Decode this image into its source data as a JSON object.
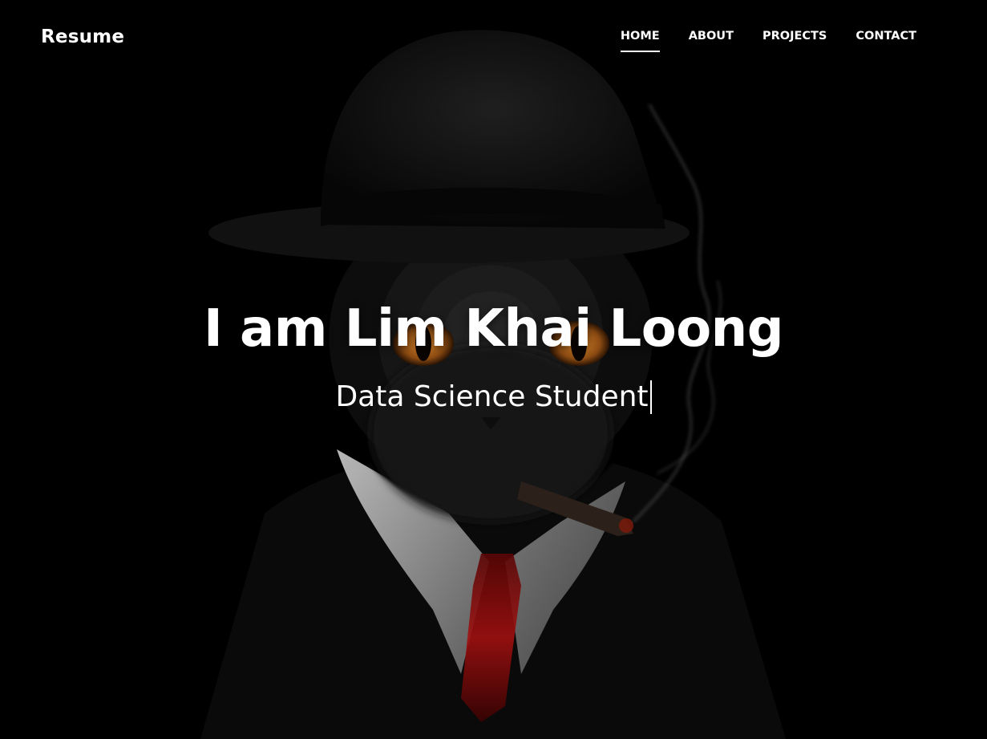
{
  "header": {
    "brand": "Resume"
  },
  "nav": {
    "items": [
      {
        "label": "HOME",
        "active": true
      },
      {
        "label": "ABOUT",
        "active": false
      },
      {
        "label": "PROJECTS",
        "active": false
      },
      {
        "label": "CONTACT",
        "active": false
      }
    ]
  },
  "hero": {
    "title": "I am Lim Khai Loong",
    "subtitle": "Data Science Student"
  },
  "colors": {
    "background": "#000000",
    "text": "#ffffff",
    "eyes": "#b8621a",
    "tie": "#8b0a0a"
  }
}
